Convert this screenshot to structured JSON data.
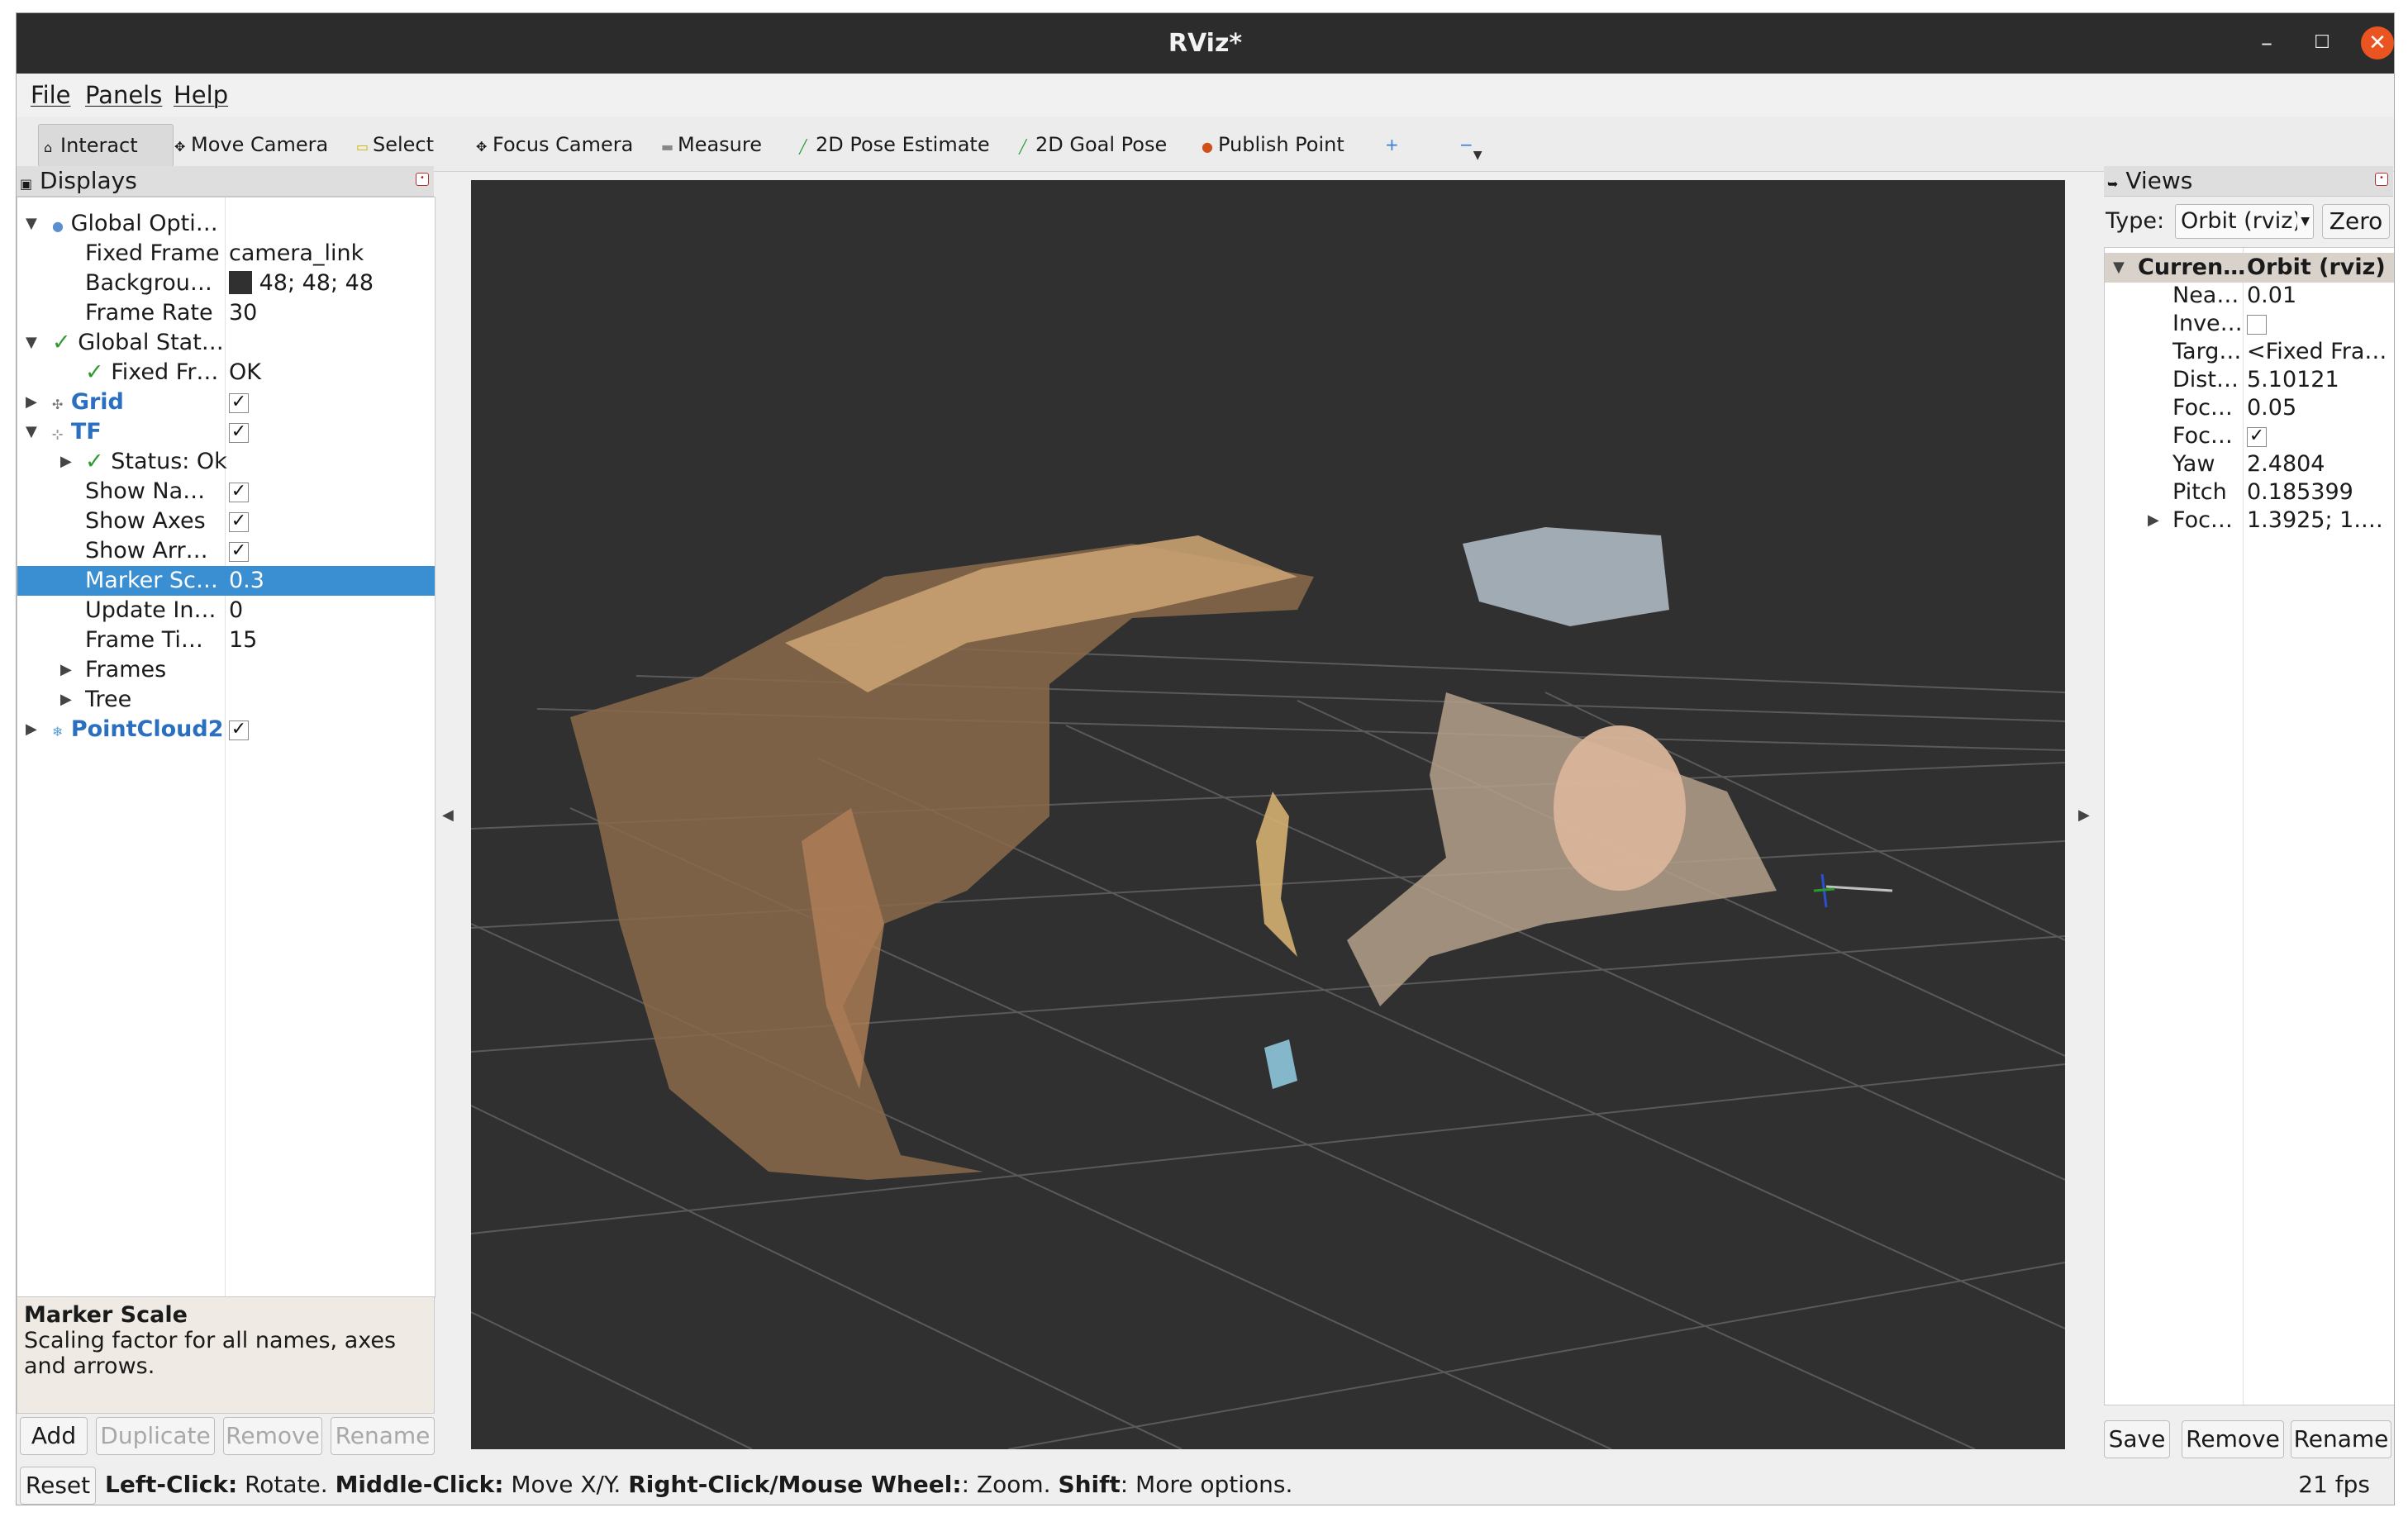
{
  "window": {
    "title": "RViz*",
    "minimize": "–",
    "maximize": "☐",
    "close": "✕"
  },
  "menu": [
    "File",
    "Panels",
    "Help"
  ],
  "toolbar": {
    "tools": [
      {
        "label": "Interact",
        "icon": "cursor-icon",
        "glyph": "⌂"
      },
      {
        "label": "Move Camera",
        "icon": "move-camera-icon",
        "glyph": "✥"
      },
      {
        "label": "Select",
        "icon": "select-icon",
        "glyph": "▭"
      },
      {
        "label": "Focus Camera",
        "icon": "focus-camera-icon",
        "glyph": "✥"
      },
      {
        "label": "Measure",
        "icon": "measure-icon",
        "glyph": "▬"
      },
      {
        "label": "2D Pose Estimate",
        "icon": "pose-estimate-icon",
        "glyph": "╱"
      },
      {
        "label": "2D Goal Pose",
        "icon": "goal-pose-icon",
        "glyph": "╱"
      },
      {
        "label": "Publish Point",
        "icon": "publish-point-icon",
        "glyph": "●"
      }
    ],
    "add_tool_glyph": "+",
    "remove_tool_glyph": "−"
  },
  "displays": {
    "header": "Displays",
    "rows": [
      {
        "name": "Global Opti…",
        "value": ""
      },
      {
        "name": "Fixed Frame",
        "value": "camera_link"
      },
      {
        "name": "Backgrou…",
        "value": "48; 48; 48"
      },
      {
        "name": "Frame Rate",
        "value": "30"
      },
      {
        "name": "Global Stat…",
        "value": ""
      },
      {
        "name": "Fixed Fr…",
        "value": "OK"
      },
      {
        "name": "Grid",
        "value": ""
      },
      {
        "name": "TF",
        "value": ""
      },
      {
        "name": "Status: Ok",
        "value": ""
      },
      {
        "name": "Show Na…",
        "value": ""
      },
      {
        "name": "Show Axes",
        "value": ""
      },
      {
        "name": "Show Arr…",
        "value": ""
      },
      {
        "name": "Marker Sc…",
        "value": "0.3"
      },
      {
        "name": "Update In…",
        "value": "0"
      },
      {
        "name": "Frame Ti…",
        "value": "15"
      },
      {
        "name": "Frames",
        "value": ""
      },
      {
        "name": "Tree",
        "value": ""
      },
      {
        "name": "PointCloud2",
        "value": ""
      }
    ],
    "background_color": "#303030",
    "check": "✓",
    "description": {
      "title": "Marker Scale",
      "text": "Scaling factor for all names, axes and arrows."
    },
    "buttons": {
      "add": "Add",
      "duplicate": "Duplicate",
      "remove": "Remove",
      "rename": "Rename"
    }
  },
  "views": {
    "header": "Views",
    "type_label": "Type:",
    "type_value": "Orbit (rviz)",
    "zero_button": "Zero",
    "current_name": "Curren…",
    "current_value": "Orbit (rviz)",
    "props": [
      {
        "name": "Nea…",
        "value": "0.01"
      },
      {
        "name": "Inve…",
        "value": ""
      },
      {
        "name": "Targ…",
        "value": "<Fixed Fra…"
      },
      {
        "name": "Dist…",
        "value": "5.10121"
      },
      {
        "name": "Foc…",
        "value": "0.05"
      },
      {
        "name": "Foc…",
        "value": ""
      },
      {
        "name": "Yaw",
        "value": "2.4804"
      },
      {
        "name": "Pitch",
        "value": "0.185399"
      },
      {
        "name": "Foc…",
        "value": "1.3925; 1.…"
      }
    ],
    "buttons": {
      "save": "Save",
      "remove": "Remove",
      "rename": "Rename"
    }
  },
  "status": {
    "reset": "Reset",
    "left_click_key": "Left-Click:",
    "left_click_text": " Rotate. ",
    "middle_click_key": "Middle-Click:",
    "middle_click_text": " Move X/Y. ",
    "right_click_key": "Right-Click/Mouse Wheel:",
    "right_click_text": ": Zoom. ",
    "shift_key": "Shift",
    "shift_text": ": More options.",
    "fps": "21 fps"
  },
  "colors": {
    "titlebar": "#2c2c2c",
    "close_button": "#e95420",
    "selection": "#3a8ed2",
    "viewport": "#303030",
    "display_name_blue": "#2a6fc0"
  }
}
